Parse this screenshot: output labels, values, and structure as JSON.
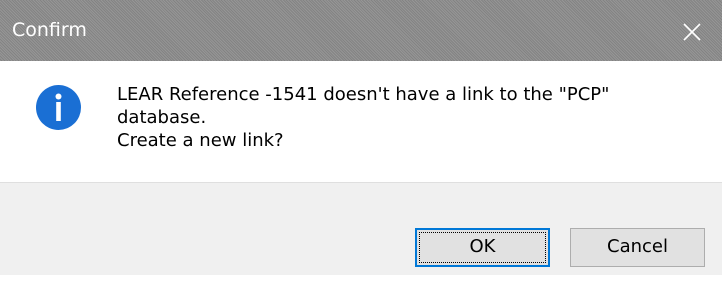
{
  "window": {
    "title": "Confirm",
    "close_icon": "close-icon"
  },
  "message": {
    "icon": "info-icon",
    "lines": [
      "LEAR Reference -1541 doesn't have a link to the \"PCP\"",
      "database.",
      "Create a new link?"
    ]
  },
  "buttons": {
    "ok_label": "OK",
    "cancel_label": "Cancel"
  },
  "colors": {
    "titlebar": "#8a8a8a",
    "accent": "#0078d7",
    "button_face": "#e1e1e1",
    "button_bar": "#f0f0f0"
  }
}
